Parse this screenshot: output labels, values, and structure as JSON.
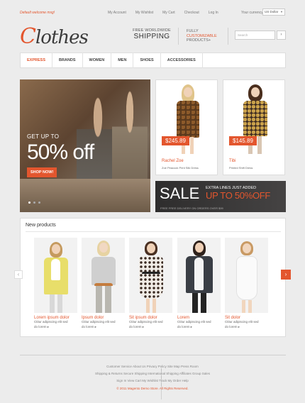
{
  "topbar": {
    "welcome": "Default welcome msg!",
    "links": [
      "My Account",
      "My Wishlist",
      "My Cart",
      "Checkout",
      "Log In"
    ],
    "currency_label": "Your currency:",
    "currency_value": "US Dollar"
  },
  "header": {
    "logo_c": "C",
    "logo_rest": "lothes",
    "ship_line1": "FREE WORLDWIDE",
    "ship_line2": "SHIPPING",
    "fully_l1": "FULLY",
    "fully_l2": "CUSTOMIZABLE",
    "fully_l3": "PRODUCTS+",
    "search_placeholder": "Search",
    "search_button": "›"
  },
  "nav": [
    "EXPRESS",
    "BRANDS",
    "WOMEN",
    "MEN",
    "SHOES",
    "ACCESSORIES"
  ],
  "hero": {
    "upto": "GET UP TO",
    "big": "50% off",
    "button": "SHOP NOW!"
  },
  "promos": [
    {
      "price": "$245.89",
      "name": "Rachel Zoe",
      "desc": "Zoe Peacock Print Silk Dress"
    },
    {
      "price": "$145.89",
      "name": "Tibi",
      "desc": "Printed Shift Dress"
    }
  ],
  "sale": {
    "word": "SALE",
    "extra": "EXTRA LINES JUST ADDED",
    "upto": "UP TO 50%OFF",
    "free": "FREE FREE DELIVERY ON ORDERS OVER $99"
  },
  "new_products": {
    "title": "New products",
    "items": [
      {
        "name": "Lorem ipsum dolor",
        "desc1": "Ctitur adipiscing elit sed",
        "desc2": "do lorem",
        "more": "do lorem ▸"
      },
      {
        "name": "Ipsum dolor",
        "desc1": "Ctitur adipiscing elit sed",
        "desc2": "do lorem",
        "more": "do lorem ▸"
      },
      {
        "name": "Sit ipsum dolor",
        "desc1": "Ctitur adipiscing elit sed",
        "desc2": "do lorem",
        "more": "do lorem ▸"
      },
      {
        "name": "Lorem",
        "desc1": "Ctitur adipiscing elit sed",
        "desc2": "do lorem",
        "more": "do lorem ▸"
      },
      {
        "name": "Sit dolor",
        "desc1": "Ctitur adipiscing elit sed",
        "desc2": "do lorem",
        "more": "do lorem ▸"
      }
    ],
    "prev": "‹",
    "next": "›"
  },
  "footer": {
    "row1": [
      "Customer Service",
      "About Us",
      "Privacy Policy",
      "Site Map",
      "Press Room"
    ],
    "row2": [
      "Shipping & Returns",
      "Secure Shipping",
      "International Shipping",
      "Affiliates",
      "Group Sales"
    ],
    "row3": [
      "Sign In",
      "View Cart",
      "My Wishlist",
      "Track My Order",
      "Help"
    ],
    "copyright": "© 2011 Magento Demo Store. All Rights Reserved."
  }
}
